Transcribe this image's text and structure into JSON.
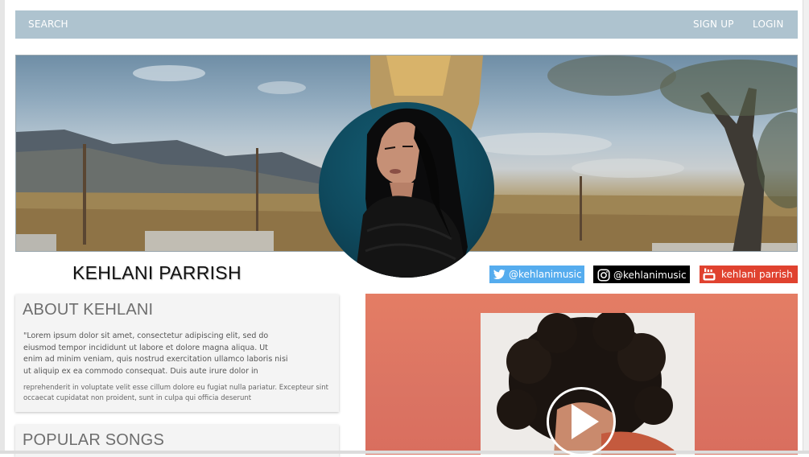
{
  "nav": {
    "search_label": "SEARCH",
    "signup_label": "SIGN UP",
    "login_label": "LOGIN",
    "bg_color": "#aec3cf"
  },
  "artist": {
    "name": "KEHLANI PARRISH"
  },
  "social": {
    "twitter": {
      "handle": "@kehlanimusic",
      "color": "#55acee",
      "icon": "twitter-bird-icon"
    },
    "instagram": {
      "handle": "@kehlanimusic",
      "color": "#000000",
      "icon": "instagram-icon"
    },
    "youtube": {
      "handle": "kehlani parrish",
      "color": "#e0422f",
      "icon": "youtube-icon"
    }
  },
  "about": {
    "title": "ABOUT KEHLANI",
    "text_1": "\"Lorem ipsum dolor sit amet, consectetur adipiscing elit, sed do eiusmod tempor incididunt ut labore et dolore magna aliqua. Ut enim ad minim veniam, quis nostrud exercitation ullamco laboris nisi ut aliquip ex ea commodo consequat. Duis aute irure dolor in",
    "text_2": "reprehenderit in voluptate velit esse cillum dolore eu fugiat nulla pariatur. Excepteur sint occaecat cupidatat non proident, sunt in culpa qui officia deserunt"
  },
  "songs": {
    "title": "POPULAR SONGS"
  },
  "feature": {
    "bg_color": "#e07a63",
    "play_icon": "play-icon"
  }
}
